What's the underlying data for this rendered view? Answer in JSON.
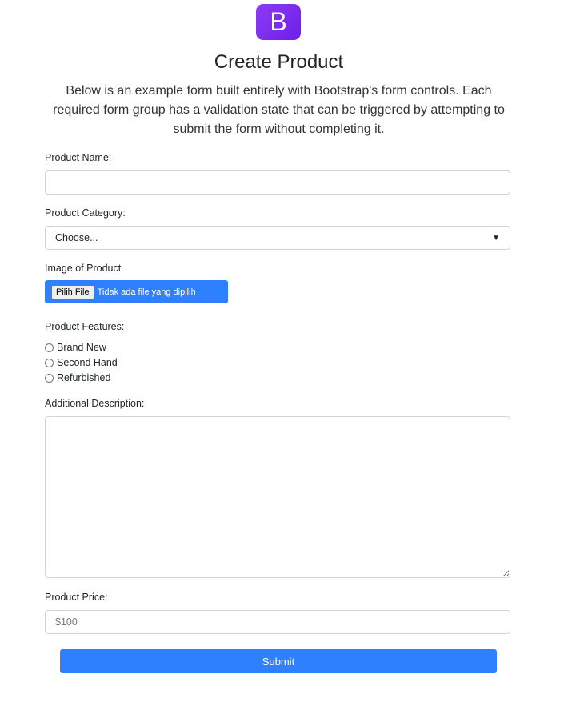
{
  "logo": "B",
  "title": "Create Product",
  "lead": "Below is an example form built entirely with Bootstrap's form controls. Each required form group has a validation state that can be triggered by attempting to submit the form without completing it.",
  "form": {
    "name_label": "Product Name:",
    "category_label": "Product Category:",
    "category_value": "Choose...",
    "image_label": "Image of Product",
    "file_button": "Pilih File",
    "file_status": "Tidak ada file yang dipilih",
    "features_label": "Product Features:",
    "features": [
      "Brand New",
      "Second Hand",
      "Refurbished"
    ],
    "description_label": "Additional Description:",
    "price_label": "Product Price:",
    "price_placeholder": "$100",
    "submit": "Submit"
  }
}
